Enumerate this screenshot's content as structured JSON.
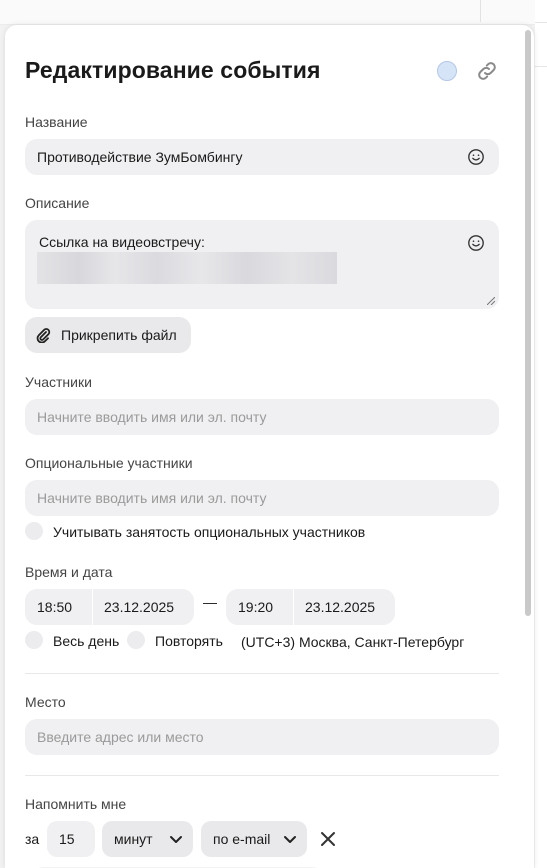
{
  "modal": {
    "title": "Редактирование события",
    "event_color": "#d6e4f7",
    "link_icon": "link-icon"
  },
  "name": {
    "label": "Название",
    "value": "Противодействие ЗумБомбингу",
    "emoji_icon": "smile-icon"
  },
  "description": {
    "label": "Описание",
    "value": "Ссылка на видеовстречу:",
    "emoji_icon": "smile-icon"
  },
  "attach": {
    "label": "Прикрепить файл",
    "icon": "paperclip-icon"
  },
  "participants": {
    "label": "Участники",
    "placeholder": "Начните вводить имя или эл. почту"
  },
  "optional_participants": {
    "label": "Опциональные участники",
    "placeholder": "Начните вводить имя или эл. почту",
    "consider_busy_label": "Учитывать занятость опциональных участников"
  },
  "datetime": {
    "label": "Время и дата",
    "start_time": "18:50",
    "start_date": "23.12.2025",
    "separator": "—",
    "end_time": "19:20",
    "end_date": "23.12.2025",
    "all_day_label": "Весь день",
    "repeat_label": "Повторять",
    "timezone": "(UTC+3) Москва, Санкт-Петербург"
  },
  "place": {
    "label": "Место",
    "placeholder": "Введите адрес или место"
  },
  "reminder": {
    "label": "Напомнить мне",
    "prefix": "за",
    "amount": "15",
    "unit": "минут",
    "channel": "по e-mail"
  }
}
